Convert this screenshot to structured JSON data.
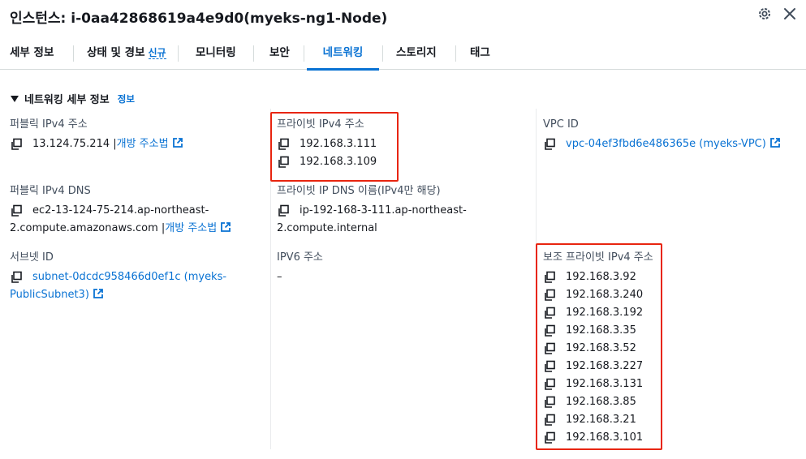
{
  "header": {
    "title": "인스턴스: i-0aa42868619a4e9d0(myeks-ng1-Node)"
  },
  "tabs": [
    {
      "label": "세부 정보"
    },
    {
      "label": "상태 및 경보",
      "badge": "신규"
    },
    {
      "label": "모니터링"
    },
    {
      "label": "보안"
    },
    {
      "label": "네트워킹",
      "active": true
    },
    {
      "label": "스토리지"
    },
    {
      "label": "태그"
    }
  ],
  "section": {
    "title": "네트워킹 세부 정보",
    "info": "정보"
  },
  "col1": {
    "public_ipv4_label": "퍼블릭 IPv4 주소",
    "public_ipv4_value": "13.124.75.214",
    "public_ipv4_link": "개방 주소법",
    "public_dns_label": "퍼블릭 IPv4 DNS",
    "public_dns_line1": "ec2-13-124-75-214.ap-northeast-",
    "public_dns_line2": "2.compute.amazonaws.com",
    "public_dns_link": "개방 주소법",
    "subnet_label": "서브넷 ID",
    "subnet_line1": "subnet-0dcdc958466d0ef1c (myeks-",
    "subnet_line2": "PublicSubnet3)"
  },
  "col2": {
    "private_ipv4_label": "프라이빗 IPv4 주소",
    "private_ipv4_values": [
      "192.168.3.111",
      "192.168.3.109"
    ],
    "private_dns_label": "프라이빗 IP DNS 이름(IPv4만 해당)",
    "private_dns_line1": "ip-192-168-3-111.ap-northeast-",
    "private_dns_line2": "2.compute.internal",
    "ipv6_label": "IPV6 주소",
    "ipv6_value": "–"
  },
  "col3": {
    "vpc_label": "VPC ID",
    "vpc_value": "vpc-04ef3fbd6e486365e (myeks-VPC)",
    "secondary_label": "보조 프라이빗 IPv4 주소",
    "secondary_values": [
      "192.168.3.92",
      "192.168.3.240",
      "192.168.3.192",
      "192.168.3.35",
      "192.168.3.52",
      "192.168.3.227",
      "192.168.3.131",
      "192.168.3.85",
      "192.168.3.21",
      "192.168.3.101"
    ]
  },
  "colors": {
    "link": "#0972d3",
    "highlight": "#e8250f"
  }
}
